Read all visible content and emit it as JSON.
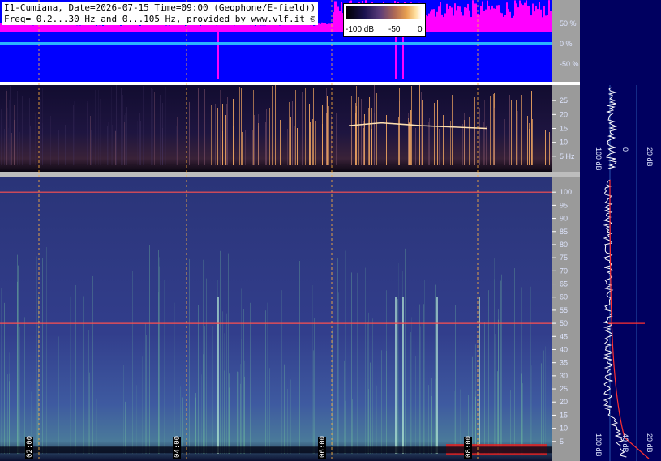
{
  "header": {
    "line1": "I1-Cumiana, Date=2026-07-15 Time=09:00 (Geophone/E-field))",
    "line2": "Freq= 0.2...30 Hz and 0...105 Hz, provided by www.vlf.it ©"
  },
  "colorbar": {
    "labels": [
      "-100 dB",
      "-50",
      "0"
    ]
  },
  "chart_data": [
    {
      "type": "area",
      "panel": "waveform",
      "yticks": [
        "50 %",
        "0 %",
        "-50 %"
      ],
      "ylim": [
        -100,
        100
      ],
      "colors": {
        "background": "#0000ff",
        "envelope": "#ff00ff",
        "trace": "#40e0ff"
      }
    },
    {
      "type": "heatmap",
      "panel": "low-frequency-spectrogram",
      "ylabel": "Hz",
      "ylim": [
        0,
        30
      ],
      "yticks": [
        5,
        10,
        15,
        20,
        25
      ],
      "profile_ticks": [
        "100 dB",
        "0",
        "20 dB"
      ]
    },
    {
      "type": "heatmap",
      "panel": "high-frequency-spectrogram",
      "ylim": [
        0,
        105
      ],
      "yticks": [
        5,
        10,
        15,
        20,
        25,
        30,
        35,
        40,
        45,
        50,
        55,
        60,
        65,
        70,
        75,
        80,
        85,
        90,
        95,
        100
      ],
      "time_ticks": [
        "02:00",
        "04:00",
        "06:00",
        "08:00"
      ],
      "profile_ticks": [
        "100 dB",
        "40 dB",
        "20 dB"
      ],
      "lines_hz": [
        50,
        100
      ]
    }
  ]
}
